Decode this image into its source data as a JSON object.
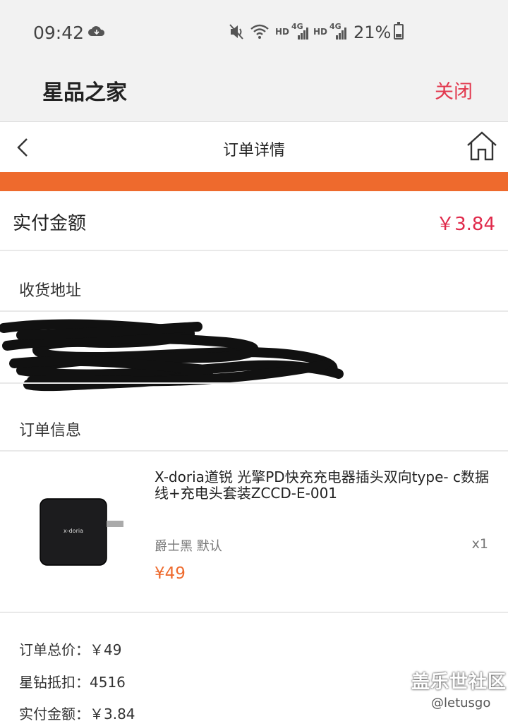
{
  "status_bar": {
    "time": "09:42",
    "network_labels": [
      "HD",
      "4G",
      "HD",
      "4G"
    ],
    "battery_percent": "21%"
  },
  "app_header": {
    "title": "星品之家",
    "close_label": "关闭"
  },
  "nav": {
    "title": "订单详情"
  },
  "payment": {
    "label": "实付金额",
    "value": "￥3.84"
  },
  "sections": {
    "address_label": "收货地址",
    "order_info_label": "订单信息"
  },
  "product": {
    "title": "X-doria道锐 光擎PD快充充电器插头双向type- c数据线+充电头套装ZCCD-E-001",
    "spec": "爵士黑 默认",
    "quantity": "x1",
    "price": "¥49",
    "image_logo_text": "x-doria"
  },
  "summary": {
    "total": "订单总价：￥49",
    "discount": "星钻抵扣：4516",
    "paid": "实付金额：￥3.84"
  },
  "watermark": {
    "title": "盖乐世社区",
    "user": "@letusgo"
  },
  "colors": {
    "accent_orange": "#ee6a2d",
    "price_red": "#e0294a",
    "close_red": "#e2394f"
  }
}
